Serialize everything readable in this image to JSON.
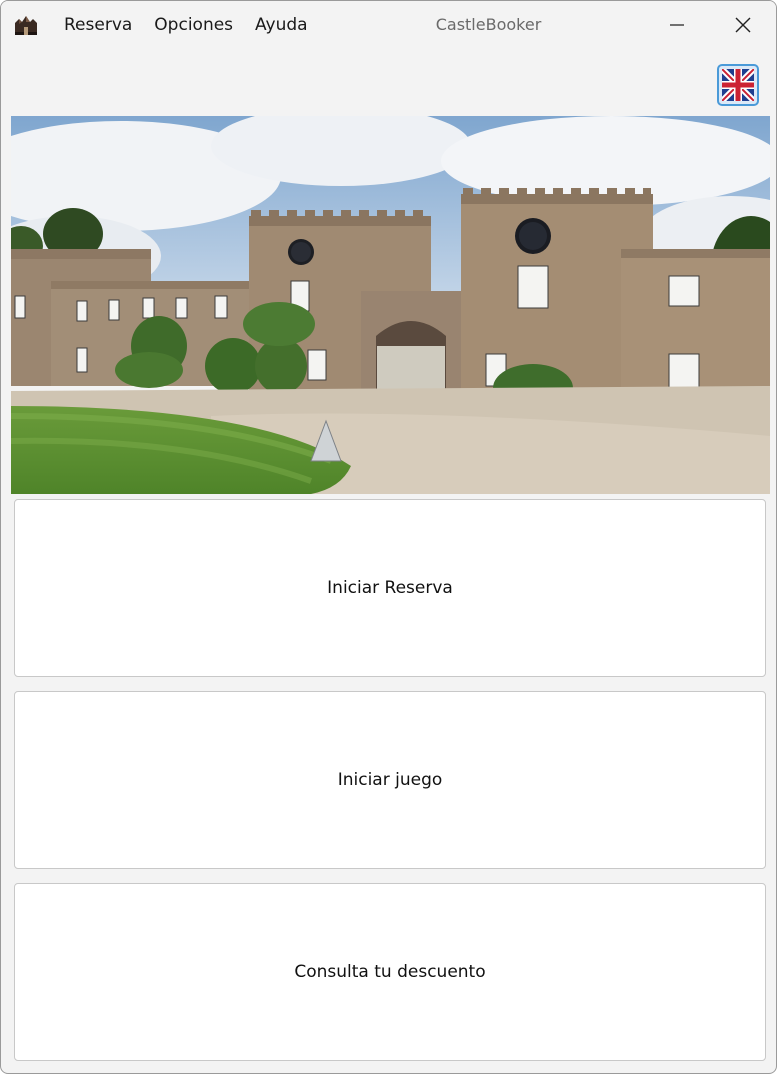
{
  "window": {
    "title": "CastleBooker"
  },
  "menu": {
    "items": [
      {
        "label": "Reserva"
      },
      {
        "label": "Opciones"
      },
      {
        "label": "Ayuda"
      }
    ]
  },
  "language_button": {
    "icon": "uk-flag-icon"
  },
  "hero": {
    "icon": "castle-photo"
  },
  "actions": {
    "start_booking": "Iniciar Reserva",
    "start_game": "Iniciar juego",
    "check_discount": "Consulta tu descuento"
  },
  "colors": {
    "window_bg": "#f3f3f3",
    "button_bg": "#ffffff",
    "language_border": "#4a9ad8"
  }
}
